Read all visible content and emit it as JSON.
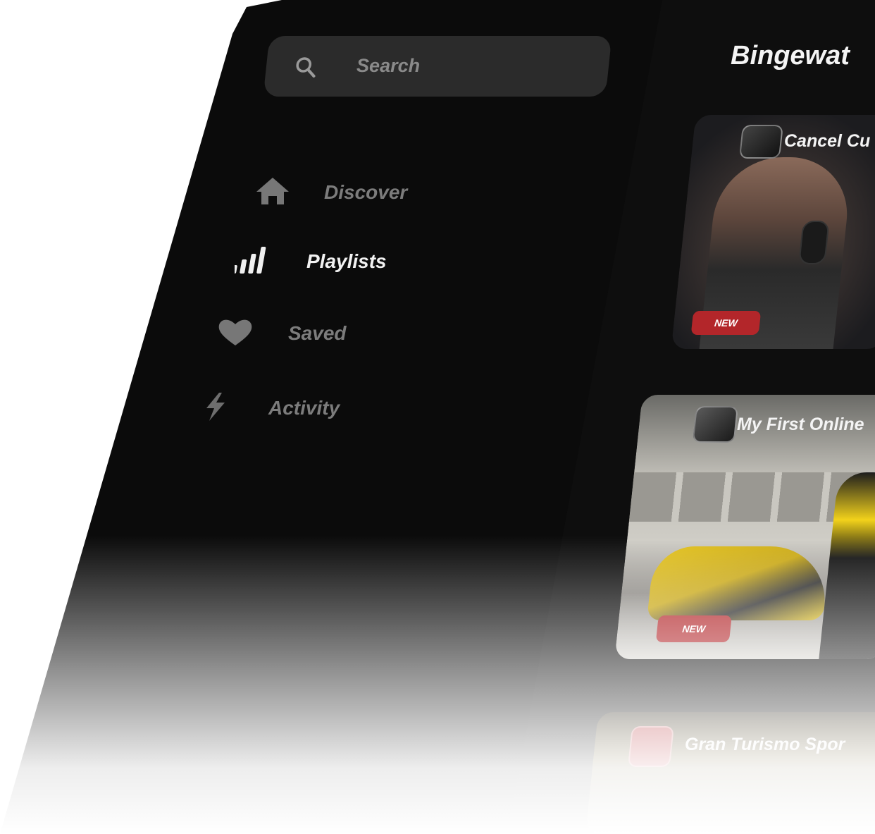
{
  "search": {
    "placeholder": "Search"
  },
  "nav": {
    "items": [
      {
        "label": "Discover",
        "icon": "home-icon",
        "active": false
      },
      {
        "label": "Playlists",
        "icon": "bars-icon",
        "active": true
      },
      {
        "label": "Saved",
        "icon": "heart-icon",
        "active": false
      },
      {
        "label": "Activity",
        "icon": "bolt-icon",
        "active": false
      }
    ]
  },
  "main": {
    "title": "Bingewat",
    "cards": [
      {
        "title": "Cancel Cu",
        "badge": "NEW"
      },
      {
        "title": "My First Online",
        "badge": "NEW"
      },
      {
        "title": "Gran Turismo Spor"
      }
    ]
  },
  "colors": {
    "background": "#0b0b0b",
    "search_bg": "#2b2b2b",
    "badge": "#b3262a",
    "active_text": "#f2f2f2",
    "inactive_text": "#7c7c7c"
  }
}
